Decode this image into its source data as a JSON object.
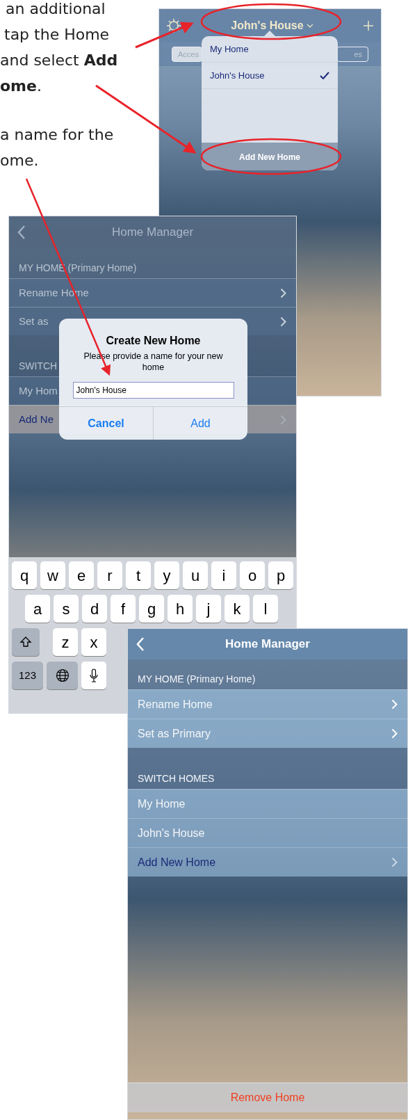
{
  "instructions": [
    {
      "text": "an additional"
    },
    {
      "text": "tap the Home"
    },
    {
      "text": "and select **Add**"
    },
    {
      "text": "**ome**."
    },
    {
      "text": "a name for the"
    },
    {
      "text": "ome."
    }
  ],
  "screen_1": {
    "title": "John's House",
    "segments": [
      "Acces",
      "es"
    ],
    "menu": {
      "items": [
        {
          "label": "My Home",
          "selected": false
        },
        {
          "label": "John's House",
          "selected": true
        }
      ],
      "action": "Add New Home"
    }
  },
  "screen_2": {
    "title": "Home Manager",
    "sections": [
      {
        "header": "MY HOME (Primary Home)",
        "rows": [
          {
            "label": "Rename Home",
            "kind": "link",
            "selected": false
          },
          {
            "label": "Set as",
            "kind": "link",
            "selected": false
          }
        ]
      },
      {
        "header": "SWITCH",
        "rows": [
          {
            "label": "My Hom",
            "kind": "home",
            "selected": false
          },
          {
            "label": "Add Ne",
            "kind": "action",
            "selected": true
          }
        ]
      }
    ],
    "dialog": {
      "title": "Create New Home",
      "message": "Please provide a name for your new home",
      "input_value": "John's House",
      "buttons": [
        {
          "label": "Cancel",
          "kind": "cancel"
        },
        {
          "label": "Add",
          "kind": "default"
        }
      ]
    },
    "keyboard": [
      [
        {
          "label": "q"
        },
        {
          "label": "w"
        },
        {
          "label": "e"
        },
        {
          "label": "r"
        },
        {
          "label": "t"
        },
        {
          "label": "y"
        },
        {
          "label": "u"
        },
        {
          "label": "i"
        },
        {
          "label": "o"
        },
        {
          "label": "p"
        }
      ],
      [
        {
          "label": "a"
        },
        {
          "label": "s"
        },
        {
          "label": "d"
        },
        {
          "label": "f"
        },
        {
          "label": "g"
        },
        {
          "label": "h"
        },
        {
          "label": "j"
        },
        {
          "label": "k"
        },
        {
          "label": "l"
        }
      ],
      [
        {
          "kind": "shift"
        },
        {
          "label": "z"
        },
        {
          "label": "x"
        }
      ],
      [
        {
          "label": "123",
          "kind": "mode"
        },
        {
          "kind": "globe"
        },
        {
          "kind": "mic"
        }
      ]
    ]
  },
  "screen_3": {
    "title": "Home Manager",
    "sections": [
      {
        "header": "MY HOME (Primary Home)",
        "rows": [
          {
            "label": "Rename Home",
            "kind": "link",
            "selected": false
          },
          {
            "label": "Set as Primary",
            "kind": "link",
            "selected": false
          }
        ]
      },
      {
        "header": "SWITCH HOMES",
        "rows": [
          {
            "label": "My Home",
            "kind": "home",
            "selected": false
          },
          {
            "label": "John's House",
            "kind": "home",
            "selected": false
          },
          {
            "label": "Add New Home",
            "kind": "action",
            "selected": false
          }
        ]
      }
    ],
    "remove_button": "Remove Home"
  }
}
